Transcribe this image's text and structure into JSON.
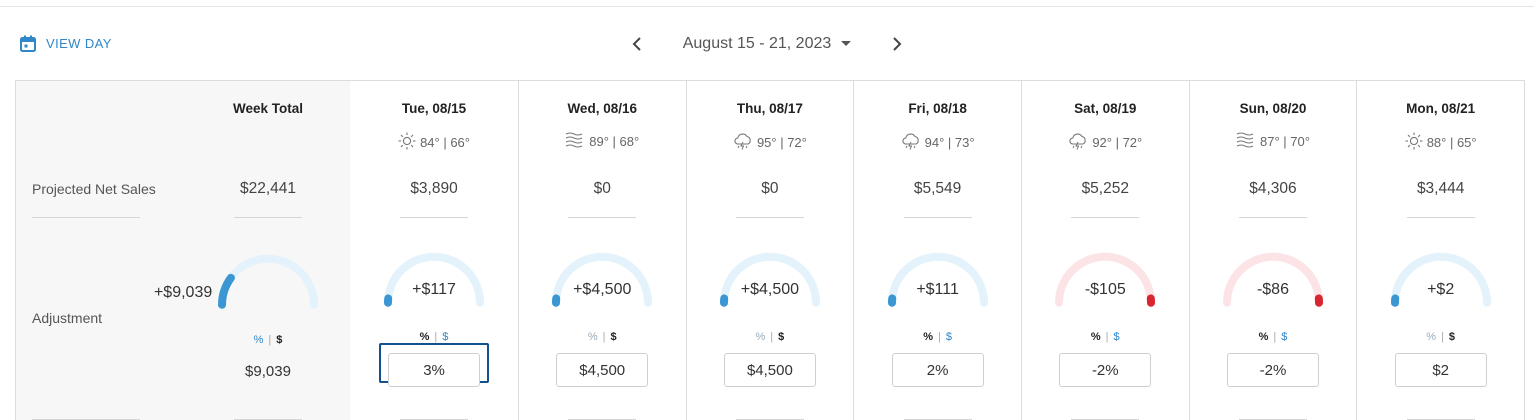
{
  "view_day": {
    "label": "VIEW DAY",
    "icon": "calendar-icon",
    "color": "#2f86c8"
  },
  "nav": {
    "prev_icon": "chevron-left-icon",
    "next_icon": "chevron-right-icon",
    "range": "August 15 - 21, 2023",
    "dropdown_icon": "caret-down-icon"
  },
  "labels": {
    "projected": "Projected Net Sales",
    "adjustment": "Adjustment"
  },
  "week": {
    "header": "Week Total",
    "sales": "$22,441",
    "adjustment": "+$9,039",
    "gauge_fraction": 0.2,
    "gauge_color": "#3a97d3",
    "toggle_pct": "%",
    "toggle_sep": "|",
    "toggle_usd": "$",
    "mode": "usd",
    "value": "$9,039"
  },
  "days": [
    {
      "header": "Tue, 08/15",
      "weather_icon": "sun-icon",
      "temps": "84° | 66°",
      "sales": "$3,890",
      "adjustment": "+$117",
      "direction": "positive",
      "gauge_fraction": 0.03,
      "mode": "pct",
      "input_value": "3%",
      "focused": true
    },
    {
      "header": "Wed, 08/16",
      "weather_icon": "wind-icon",
      "temps": "89° | 68°",
      "sales": "$0",
      "adjustment": "+$4,500",
      "direction": "positive",
      "gauge_fraction": 0,
      "mode": "usd",
      "input_value": "$4,500",
      "focused": false
    },
    {
      "header": "Thu, 08/17",
      "weather_icon": "thunderstorm-icon",
      "temps": "95° | 72°",
      "sales": "$0",
      "adjustment": "+$4,500",
      "direction": "positive",
      "gauge_fraction": 0,
      "mode": "usd",
      "input_value": "$4,500",
      "focused": false
    },
    {
      "header": "Fri, 08/18",
      "weather_icon": "thunderstorm-icon",
      "temps": "94° | 73°",
      "sales": "$5,549",
      "adjustment": "+$111",
      "direction": "positive",
      "gauge_fraction": 0.02,
      "mode": "pct",
      "input_value": "2%",
      "focused": false
    },
    {
      "header": "Sat, 08/19",
      "weather_icon": "thunderstorm-icon",
      "temps": "92° | 72°",
      "sales": "$5,252",
      "adjustment": "-$105",
      "direction": "negative",
      "gauge_fraction": 0.02,
      "mode": "pct",
      "input_value": "-2%",
      "focused": false
    },
    {
      "header": "Sun, 08/20",
      "weather_icon": "wind-icon",
      "temps": "87° | 70°",
      "sales": "$4,306",
      "adjustment": "-$86",
      "direction": "negative",
      "gauge_fraction": 0.02,
      "mode": "pct",
      "input_value": "-2%",
      "focused": false
    },
    {
      "header": "Mon, 08/21",
      "weather_icon": "sun-icon",
      "temps": "88° | 65°",
      "sales": "$3,444",
      "adjustment": "+$2",
      "direction": "positive",
      "gauge_fraction": 0,
      "mode": "usd",
      "input_value": "$2",
      "focused": false
    }
  ],
  "colors": {
    "positive_track": "#e3f2fb",
    "positive_fill": "#3a97d3",
    "negative_track": "#fce4e6",
    "negative_fill": "#d9252f",
    "focus": "#12508f"
  }
}
